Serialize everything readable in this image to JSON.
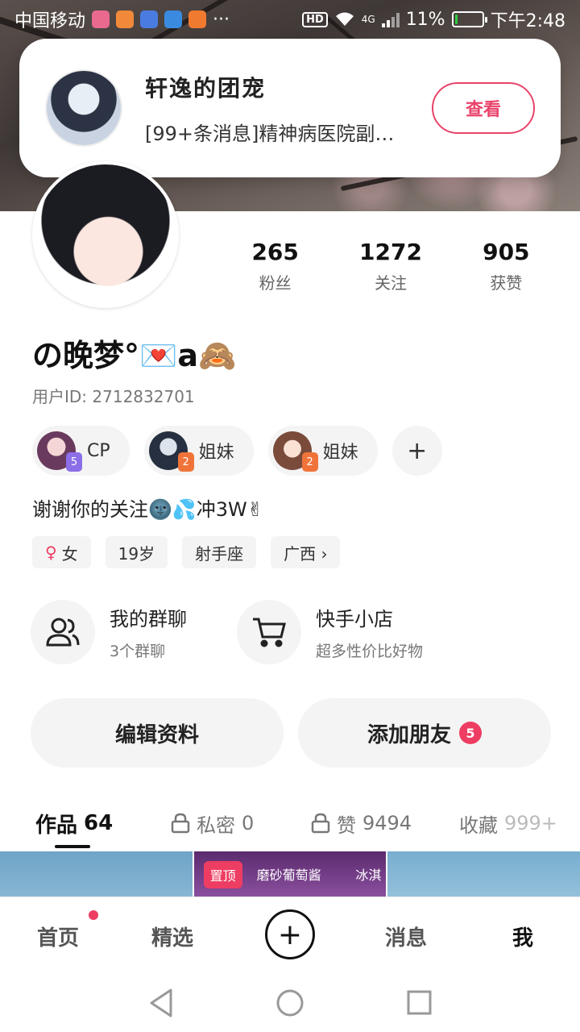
{
  "status_bar": {
    "carrier": "中国移动",
    "overflow": "···",
    "hd": "HD",
    "network": "4G",
    "battery_percent": "11%",
    "battery_level": 0.11,
    "time": "下午2:48"
  },
  "notification": {
    "title": "轩逸的团宠",
    "message": "[99+条消息]精神病医院副…",
    "button": "查看"
  },
  "profile": {
    "stats": [
      {
        "value": "265",
        "label": "粉丝"
      },
      {
        "value": "1272",
        "label": "关注"
      },
      {
        "value": "905",
        "label": "获赞"
      }
    ],
    "nickname": "の晚梦°💌a🙈",
    "user_id": "用户ID: 2712832701",
    "relations": [
      {
        "badge": "5",
        "label": "CP",
        "badge_color": "#8b6ee8"
      },
      {
        "badge": "2",
        "label": "姐妹",
        "badge_color": "#f0743a"
      },
      {
        "badge": "2",
        "label": "姐妹",
        "badge_color": "#f0743a"
      }
    ],
    "add_relation": "+",
    "bio": "谢谢你的关注🌚💦冲3W✌",
    "tags": [
      {
        "icon": "♀",
        "text": "女"
      },
      {
        "text": "19岁"
      },
      {
        "text": "射手座"
      },
      {
        "text": "广西 ›"
      }
    ]
  },
  "features": [
    {
      "icon": "group-chat-icon",
      "title": "我的群聊",
      "subtitle": "3个群聊"
    },
    {
      "icon": "shopping-cart-icon",
      "title": "快手小店",
      "subtitle": "超多性价比好物"
    }
  ],
  "actions": {
    "edit_profile": "编辑资料",
    "add_friend": "添加朋友",
    "add_friend_count": "5"
  },
  "tabs": [
    {
      "label": "作品",
      "count": "64",
      "locked": false,
      "active": true
    },
    {
      "label": "私密",
      "count": "0",
      "locked": true,
      "active": false
    },
    {
      "label": "赞",
      "count": "9494",
      "locked": true,
      "active": false
    },
    {
      "label": "收藏",
      "count": "999+",
      "locked": false,
      "active": false
    }
  ],
  "grid": {
    "pin_label": "置顶",
    "caption": "磨砂葡萄酱",
    "caption2": "冰淇"
  },
  "bottom_nav": {
    "home": "首页",
    "featured": "精选",
    "publish": "+",
    "messages": "消息",
    "me": "我"
  },
  "colors": {
    "accent": "#ee3d62",
    "notify_button": "#e9436a"
  }
}
